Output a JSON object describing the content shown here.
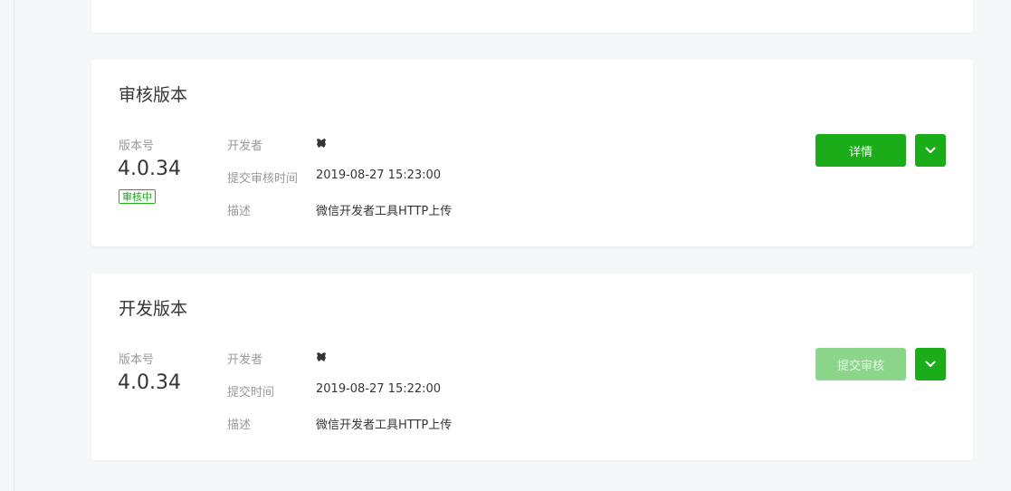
{
  "review_version": {
    "title": "审核版本",
    "version_label": "版本号",
    "version": "4.0.34",
    "status": "审核中",
    "developer_label": "开发者",
    "time_label": "提交审核时间",
    "time": "2019-08-27 15:23:00",
    "desc_label": "描述",
    "desc": "微信开发者工具HTTP上传",
    "primary_button": "详情"
  },
  "dev_version": {
    "title": "开发版本",
    "version_label": "版本号",
    "version": "4.0.34",
    "developer_label": "开发者",
    "time_label": "提交时间",
    "time": "2019-08-27 15:22:00",
    "desc_label": "描述",
    "desc": "微信开发者工具HTTP上传",
    "primary_button": "提交审核"
  },
  "colors": {
    "brand": "#1aad19",
    "brand_disabled": "#8cd68c",
    "background": "#f6f7f9"
  },
  "icons": {
    "developer": "developer-avatar-icon",
    "dropdown": "chevron-down-icon"
  }
}
